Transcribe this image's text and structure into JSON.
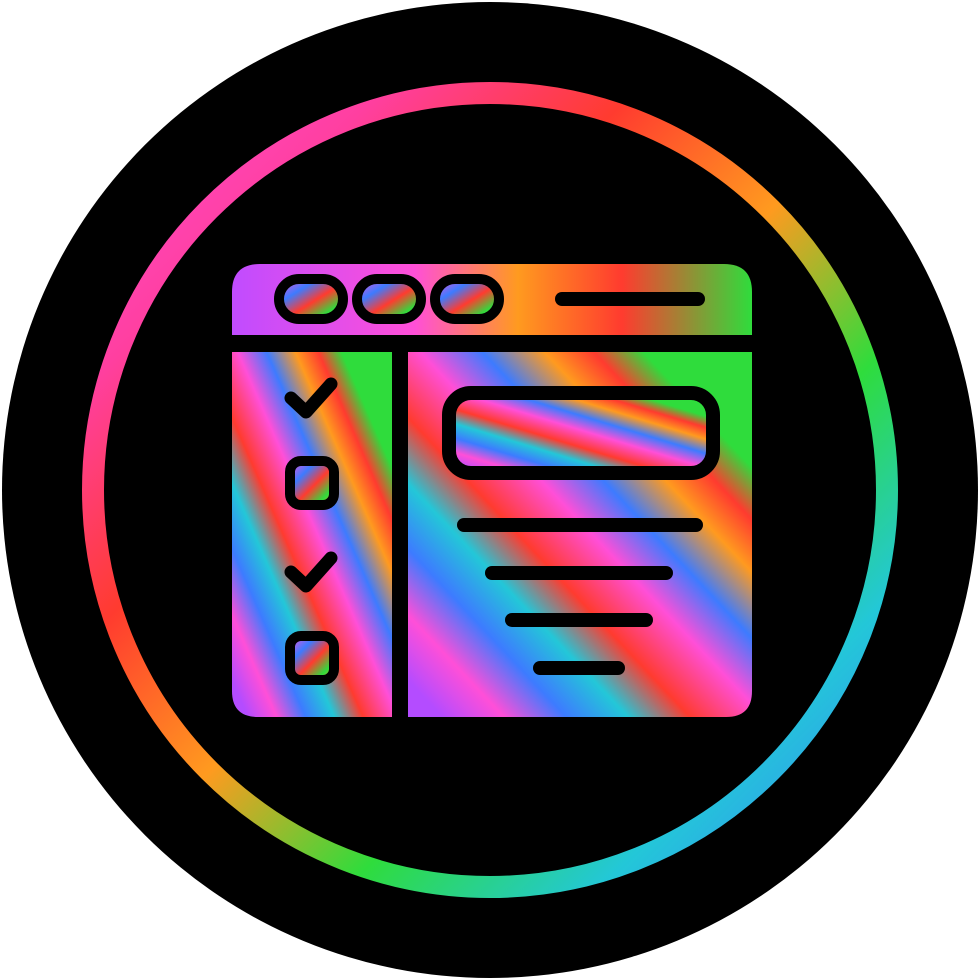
{
  "icon": {
    "name": "checklist-web-page-icon",
    "style": "glyph with rainbow gradient fill on black circle badge",
    "background_color": "#000000",
    "gradient_colors": [
      "#ff3fa0",
      "#ff3b2f",
      "#ff9a1f",
      "#2fdc3c",
      "#23c7d8",
      "#3d7bff",
      "#b44cff",
      "#ff4fd8"
    ]
  },
  "window": {
    "header_dots": 3,
    "sidebar_rows": [
      {
        "kind": "check",
        "checked": true
      },
      {
        "kind": "checkbox",
        "checked": false
      },
      {
        "kind": "check",
        "checked": true
      },
      {
        "kind": "checkbox",
        "checked": false
      }
    ],
    "content_lines": 4
  }
}
